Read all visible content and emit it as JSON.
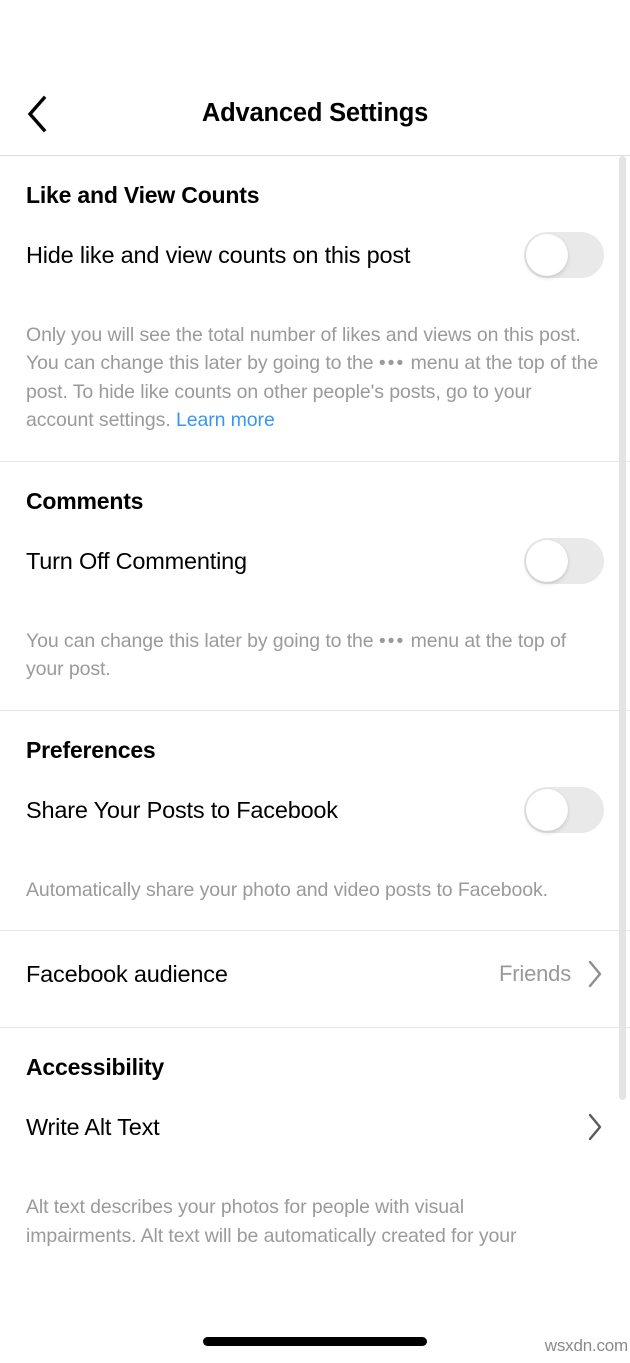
{
  "header": {
    "title": "Advanced Settings",
    "back_icon": "chevron-left-icon"
  },
  "sections": [
    {
      "id": "like-and-view-counts",
      "title": "Like and View Counts",
      "row_label": "Hide like and view counts on this post",
      "toggle_state": "off",
      "help_part1": "Only you will see the total number of likes and views on this post. You can change this later by going to the ",
      "help_dots": "•••",
      "help_part2": " menu at the top of the post. To hide like counts on other people's posts, go to your account settings. ",
      "help_link": "Learn more"
    },
    {
      "id": "comments",
      "title": "Comments",
      "row_label": "Turn Off Commenting",
      "toggle_state": "off",
      "help_part1": "You can change this later by going to the ",
      "help_dots": "•••",
      "help_part2": " menu at the top of your post."
    },
    {
      "id": "preferences",
      "title": "Preferences",
      "row_label": "Share Your Posts to Facebook",
      "toggle_state": "off",
      "help_part1": "Automatically share your photo and video posts to Facebook."
    },
    {
      "id": "facebook-audience",
      "row_label": "Facebook audience",
      "row_value": "Friends",
      "chevron_icon": "chevron-right-icon"
    },
    {
      "id": "accessibility",
      "title": "Accessibility",
      "row_label": "Write Alt Text",
      "chevron_icon": "chevron-right-icon",
      "help_part1": "Alt text describes your photos for people with visual impairments. Alt text will be automatically created for your"
    }
  ],
  "colors": {
    "accent_link": "#3897f0",
    "toggle_off_track": "#e9e9ea",
    "toggle_knob": "#ffffff",
    "help_text": "#9a9a9a",
    "value_text": "#999999",
    "divider": "#e6e6e6",
    "scrollbar": "#e4e4e4",
    "text_primary": "#000000"
  },
  "watermark": "wsxdn.com"
}
